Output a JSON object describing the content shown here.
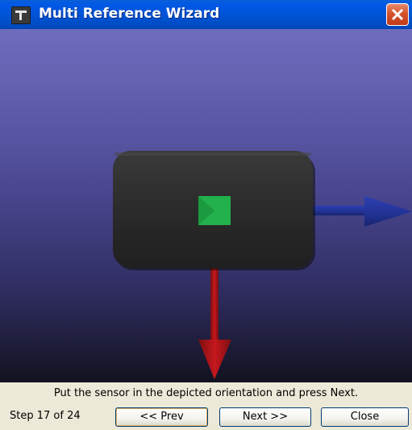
{
  "window": {
    "title": "Multi Reference Wizard",
    "icons": {
      "app": "tool-icon",
      "close": "close-icon"
    }
  },
  "scene": {
    "description_icons": [
      "sensor-device",
      "led-indicator",
      "x-axis-arrow",
      "y-axis-arrow"
    ],
    "colors": {
      "sensor_body": "#2b2b2b",
      "led": "#22b14c",
      "blue_arrow": "#23349a",
      "red_arrow": "#b5161c"
    }
  },
  "footer": {
    "instruction": "Put the sensor in the depicted orientation and press Next.",
    "step": "Step 17 of 24",
    "prev_label": "<< Prev",
    "next_label": "Next >>",
    "close_label": "Close"
  }
}
